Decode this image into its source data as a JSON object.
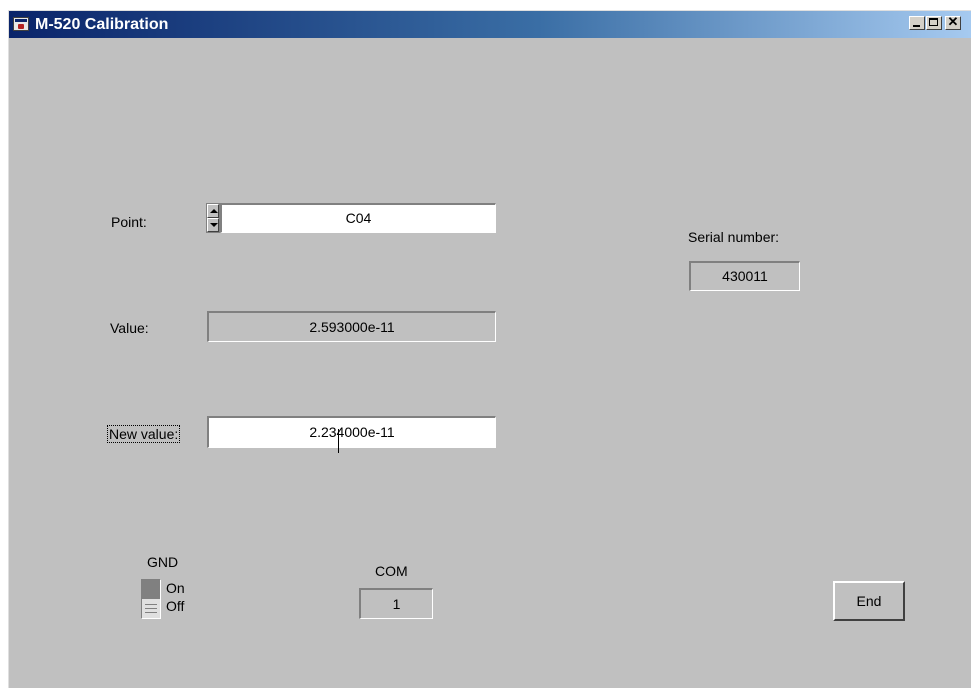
{
  "window": {
    "title": "M-520 Calibration"
  },
  "point": {
    "label": "Point:",
    "value": "C04"
  },
  "value": {
    "label": "Value:",
    "value": "2.593000e-11"
  },
  "new_value": {
    "label": "New value:",
    "value": "2.234000e-11"
  },
  "serial": {
    "label": "Serial number:",
    "value": "430011"
  },
  "gnd": {
    "label": "GND",
    "on_label": "On",
    "off_label": "Off",
    "state": "On"
  },
  "com": {
    "label": "COM",
    "value": "1"
  },
  "end_button": {
    "label": "End"
  },
  "colors": {
    "window_bg": "#c0c0c0",
    "titlebar_start": "#0a246a",
    "titlebar_end": "#a6caf0"
  },
  "icons": [
    "labview-app-icon",
    "minimize-icon",
    "maximize-icon",
    "close-icon",
    "spinner-up-icon",
    "spinner-down-icon"
  ]
}
